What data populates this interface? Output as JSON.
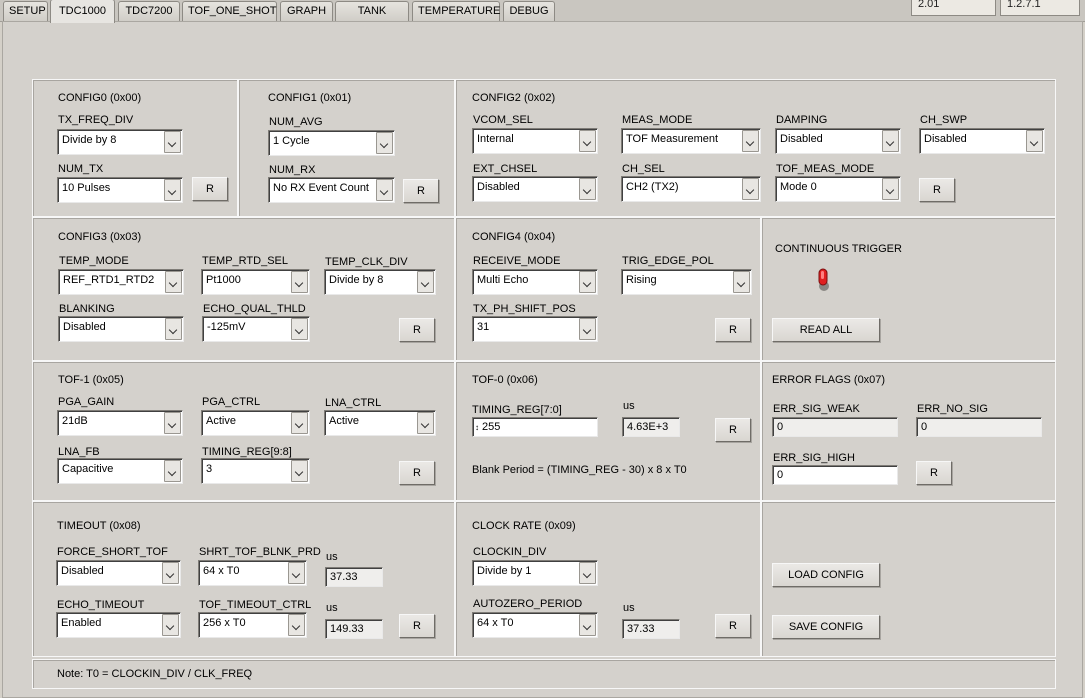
{
  "tabs": [
    "SETUP",
    "TDC1000",
    "TDC7200",
    "TOF_ONE_SHOT",
    "GRAPH",
    "TANK LEVEL",
    "TEMPERATURE",
    "DEBUG"
  ],
  "versions": [
    "2.01",
    "1.2.7.1"
  ],
  "config0": {
    "title": "CONFIG0 (0x00)",
    "tx_freq_div_label": "TX_FREQ_DIV",
    "tx_freq_div": "Divide by 8",
    "num_tx_label": "NUM_TX",
    "num_tx": "10 Pulses",
    "reset": "R"
  },
  "config1": {
    "title": "CONFIG1 (0x01)",
    "num_avg_label": "NUM_AVG",
    "num_avg": "1 Cycle",
    "num_rx_label": "NUM_RX",
    "num_rx": "No RX Event Count",
    "reset": "R"
  },
  "config2": {
    "title": "CONFIG2 (0x02)",
    "vcom_sel_label": "VCOM_SEL",
    "vcom_sel": "Internal",
    "meas_mode_label": "MEAS_MODE",
    "meas_mode": "TOF Measurement",
    "damping_label": "DAMPING",
    "damping": "Disabled",
    "ch_swp_label": "CH_SWP",
    "ch_swp": "Disabled",
    "ext_chsel_label": "EXT_CHSEL",
    "ext_chsel": "Disabled",
    "ch_sel_label": "CH_SEL",
    "ch_sel": "CH2 (TX2)",
    "tof_meas_mode_label": "TOF_MEAS_MODE",
    "tof_meas_mode": "Mode 0",
    "reset": "R"
  },
  "config3": {
    "title": "CONFIG3 (0x03)",
    "temp_mode_label": "TEMP_MODE",
    "temp_mode": "REF_RTD1_RTD2",
    "temp_rtd_sel_label": "TEMP_RTD_SEL",
    "temp_rtd_sel": "Pt1000",
    "temp_clk_div_label": "TEMP_CLK_DIV",
    "temp_clk_div": "Divide by 8",
    "blanking_label": "BLANKING",
    "blanking": "Disabled",
    "echo_qual_thld_label": "ECHO_QUAL_THLD",
    "echo_qual_thld": "-125mV",
    "reset": "R"
  },
  "config4": {
    "title": "CONFIG4 (0x04)",
    "receive_mode_label": "RECEIVE_MODE",
    "receive_mode": "Multi Echo",
    "trig_edge_pol_label": "TRIG_EDGE_POL",
    "trig_edge_pol": "Rising",
    "tx_ph_shift_pos_label": "TX_PH_SHIFT_POS",
    "tx_ph_shift_pos": "31",
    "reset": "R"
  },
  "continuous": {
    "label": "CONTINUOUS TRIGGER",
    "read_all": "READ ALL",
    "toggle_color": "#e02020"
  },
  "tof1": {
    "title": "TOF-1 (0x05)",
    "pga_gain_label": "PGA_GAIN",
    "pga_gain": "21dB",
    "pga_ctrl_label": "PGA_CTRL",
    "pga_ctrl": "Active",
    "lna_ctrl_label": "LNA_CTRL",
    "lna_ctrl": "Active",
    "lna_fb_label": "LNA_FB",
    "lna_fb": "Capacitive",
    "timing_reg_hi_label": "TIMING_REG[9:8]",
    "timing_reg_hi": "3",
    "reset": "R"
  },
  "tof0": {
    "title": "TOF-0 (0x06)",
    "timing_reg_lo_label": "TIMING_REG[7:0]",
    "timing_reg_lo": "255",
    "us_label": "us",
    "us_value": "4.63E+3",
    "note": "Blank Period = (TIMING_REG - 30) x 8 x T0",
    "reset": "R"
  },
  "errors": {
    "title": "ERROR FLAGS (0x07)",
    "sig_weak_label": "ERR_SIG_WEAK",
    "sig_weak": "0",
    "no_sig_label": "ERR_NO_SIG",
    "no_sig": "0",
    "sig_high_label": "ERR_SIG_HIGH",
    "sig_high": "0",
    "reset": "R"
  },
  "timeout": {
    "title": "TIMEOUT (0x08)",
    "force_short_tof_label": "FORCE_SHORT_TOF",
    "force_short_tof": "Disabled",
    "shrt_tof_blnk_prd_label": "SHRT_TOF_BLNK_PRD",
    "shrt_tof_blnk_prd": "64 x T0",
    "us1_label": "us",
    "us1_value": "37.33",
    "echo_timeout_label": "ECHO_TIMEOUT",
    "echo_timeout": "Enabled",
    "tof_timeout_ctrl_label": "TOF_TIMEOUT_CTRL",
    "tof_timeout_ctrl": "256 x T0",
    "us2_label": "us",
    "us2_value": "149.33",
    "reset": "R"
  },
  "clock": {
    "title": "CLOCK RATE (0x09)",
    "clockin_div_label": "CLOCKIN_DIV",
    "clockin_div": "Divide by 1",
    "autozero_period_label": "AUTOZERO_PERIOD",
    "autozero_period": "64 x T0",
    "us_label": "us",
    "us_value": "37.33",
    "reset": "R"
  },
  "actions": {
    "load": "LOAD CONFIG",
    "save": "SAVE CONFIG"
  },
  "footer_note": "Note: T0 = CLOCKIN_DIV / CLK_FREQ"
}
